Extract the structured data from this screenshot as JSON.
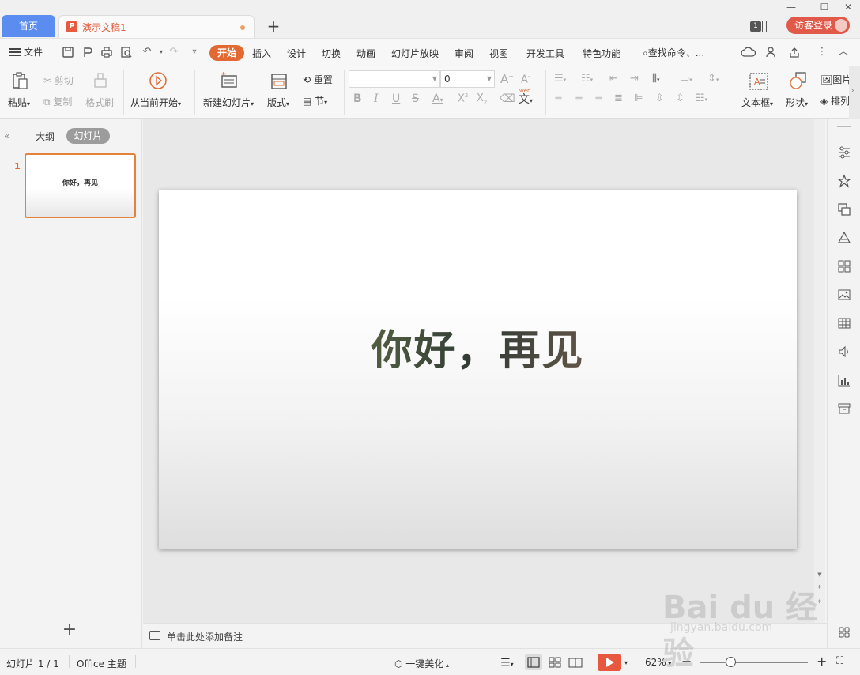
{
  "tabs": {
    "home": "首页",
    "document": "演示文稿1",
    "add": "+"
  },
  "window": {
    "badge": "1",
    "login": "访客登录"
  },
  "menu": {
    "file": "文件",
    "active": "开始",
    "items": [
      "插入",
      "设计",
      "切换",
      "动画",
      "幻灯片放映",
      "审阅",
      "视图",
      "开发工具",
      "特色功能"
    ],
    "search": "查找命令、..."
  },
  "ribbon": {
    "paste": "粘贴",
    "cut": "剪切",
    "copy": "复制",
    "format_painter": "格式刷",
    "from_current": "从当前开始",
    "new_slide": "新建幻灯片",
    "layout": "版式",
    "reset": "重置",
    "section": "节",
    "font_size": "0",
    "textbox": "文本框",
    "shape": "形状",
    "picture": "图片",
    "arrange": "排列"
  },
  "left_panel": {
    "outline_tab": "大纲",
    "slides_tab": "幻灯片",
    "thumb_number": "1",
    "thumb_text": "你好，再见"
  },
  "slide": {
    "title": "你好，再见"
  },
  "notes": {
    "placeholder": "单击此处添加备注"
  },
  "status": {
    "slide_count": "幻灯片 1 / 1",
    "theme": "Office 主题",
    "beautify": "一键美化",
    "zoom": "62%"
  },
  "watermark": {
    "main": "Bai du 经验",
    "sub": "jingyan.baidu.com"
  },
  "colors": {
    "accent": "#e26a32",
    "home_tab": "#5b8cf0",
    "login": "#e15949",
    "play": "#e8583f"
  }
}
